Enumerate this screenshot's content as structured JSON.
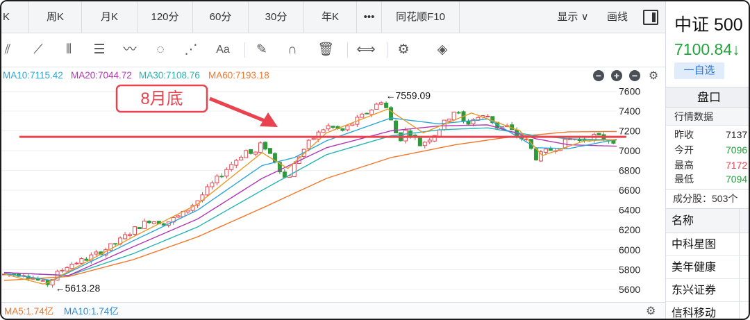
{
  "tabs": [
    {
      "label": "K"
    },
    {
      "label": "周K"
    },
    {
      "label": "月K"
    },
    {
      "label": "120分"
    },
    {
      "label": "60分"
    },
    {
      "label": "30分"
    },
    {
      "label": "年K"
    },
    {
      "label": "•••"
    },
    {
      "label": "同花顺F10"
    }
  ],
  "tab_right": {
    "display_label": "显示 ∨",
    "draw_label": "画线"
  },
  "ma_legend": [
    {
      "label": "MA10:7115.42",
      "color": "#2aa6d8"
    },
    {
      "label": "MA20:7044.72",
      "color": "#b235b3"
    },
    {
      "label": "MA30:7108.76",
      "color": "#27b3b3"
    },
    {
      "label": "MA60:7193.18",
      "color": "#f2762a"
    }
  ],
  "volume_legend": [
    {
      "label": "MA5:1.74亿",
      "color": "#f2762a"
    },
    {
      "label": "MA10:1.74亿",
      "color": "#2a8ad8"
    }
  ],
  "annotation": {
    "text": "8月底",
    "color": "#e8434f"
  },
  "chart_data": {
    "type": "candlestick",
    "ylim": [
      5480,
      7680
    ],
    "yticks": [
      5600,
      5800,
      6000,
      6200,
      6400,
      6600,
      6800,
      7000,
      7200,
      7400,
      7600
    ],
    "high_label": "←7559.09",
    "low_label": "←5613.28",
    "horizontal_line": 7140,
    "colors": {
      "up": "#e8434f",
      "down": "#2e9a3a",
      "ma5": "#e89a2a",
      "ma10": "#2aa6d8",
      "ma20": "#b235b3",
      "ma30": "#27b3b3",
      "ma60": "#f2762a",
      "hline": "#e8434f"
    },
    "ohlc_anchors": [
      [
        0,
        5750
      ],
      [
        12,
        5760
      ],
      [
        20,
        5700
      ],
      [
        26,
        5640
      ],
      [
        33,
        5760
      ],
      [
        40,
        5850
      ],
      [
        50,
        5900
      ],
      [
        60,
        5980
      ],
      [
        70,
        6070
      ],
      [
        80,
        6200
      ],
      [
        90,
        6300
      ],
      [
        100,
        6270
      ],
      [
        110,
        6350
      ],
      [
        120,
        6500
      ],
      [
        130,
        6680
      ],
      [
        140,
        6850
      ],
      [
        150,
        7000
      ],
      [
        155,
        6950
      ],
      [
        160,
        7080
      ],
      [
        168,
        6900
      ],
      [
        175,
        6700
      ],
      [
        183,
        6950
      ],
      [
        190,
        7100
      ],
      [
        200,
        7250
      ],
      [
        210,
        7200
      ],
      [
        218,
        7300
      ],
      [
        228,
        7420
      ],
      [
        235,
        7520
      ],
      [
        240,
        7300
      ],
      [
        245,
        7100
      ],
      [
        250,
        7220
      ],
      [
        258,
        7060
      ],
      [
        266,
        7150
      ],
      [
        274,
        7300
      ],
      [
        280,
        7420
      ],
      [
        286,
        7260
      ],
      [
        292,
        7330
      ],
      [
        300,
        7350
      ],
      [
        306,
        7240
      ],
      [
        312,
        7240
      ],
      [
        318,
        7150
      ],
      [
        324,
        7100
      ],
      [
        330,
        6930
      ],
      [
        336,
        6990
      ],
      [
        344,
        7040
      ],
      [
        352,
        7130
      ],
      [
        358,
        7100
      ],
      [
        366,
        7150
      ],
      [
        372,
        7120
      ],
      [
        380,
        7100
      ]
    ],
    "ma_anchors": {
      "ma60": [
        [
          0,
          5690
        ],
        [
          40,
          5730
        ],
        [
          80,
          5900
        ],
        [
          120,
          6130
        ],
        [
          160,
          6420
        ],
        [
          200,
          6720
        ],
        [
          240,
          6930
        ],
        [
          280,
          7060
        ],
        [
          310,
          7130
        ],
        [
          350,
          7190
        ],
        [
          380,
          7193
        ]
      ],
      "ma30": [
        [
          0,
          5770
        ],
        [
          40,
          5740
        ],
        [
          80,
          5960
        ],
        [
          120,
          6230
        ],
        [
          160,
          6600
        ],
        [
          200,
          6960
        ],
        [
          240,
          7150
        ],
        [
          270,
          7210
        ],
        [
          300,
          7230
        ],
        [
          330,
          7150
        ],
        [
          350,
          7120
        ],
        [
          380,
          7108
        ]
      ],
      "ma20": [
        [
          0,
          5770
        ],
        [
          40,
          5740
        ],
        [
          80,
          6030
        ],
        [
          120,
          6310
        ],
        [
          160,
          6720
        ],
        [
          200,
          7030
        ],
        [
          240,
          7200
        ],
        [
          270,
          7250
        ],
        [
          300,
          7260
        ],
        [
          330,
          7120
        ],
        [
          350,
          7060
        ],
        [
          380,
          7045
        ]
      ],
      "ma10": [
        [
          0,
          5760
        ],
        [
          30,
          5690
        ],
        [
          80,
          6090
        ],
        [
          120,
          6400
        ],
        [
          160,
          6850
        ],
        [
          180,
          6930
        ],
        [
          200,
          7100
        ],
        [
          240,
          7330
        ],
        [
          270,
          7270
        ],
        [
          300,
          7320
        ],
        [
          330,
          7030
        ],
        [
          350,
          7020
        ],
        [
          380,
          7115
        ]
      ],
      "ma5": [
        [
          0,
          5755
        ],
        [
          25,
          5650
        ],
        [
          80,
          6130
        ],
        [
          120,
          6460
        ],
        [
          160,
          6980
        ],
        [
          176,
          6820
        ],
        [
          200,
          7180
        ],
        [
          238,
          7420
        ],
        [
          260,
          7180
        ],
        [
          290,
          7380
        ],
        [
          320,
          7200
        ],
        [
          334,
          6950
        ],
        [
          360,
          7100
        ],
        [
          380,
          7110
        ]
      ]
    }
  },
  "panel": {
    "name": "中证 500",
    "price": "7100.84↓",
    "watch_button": "一自选",
    "header": "盘口",
    "subheader": "行情数据",
    "quotes": [
      {
        "label": "昨收",
        "value": "7137",
        "color": "#222222"
      },
      {
        "label": "今开",
        "value": "7096",
        "color": "#24a33c"
      },
      {
        "label": "最高",
        "value": "7172",
        "color": "#e8434f"
      },
      {
        "label": "最低",
        "value": "7094",
        "color": "#24a33c"
      }
    ],
    "count_label": "成分股：503个",
    "list_header": "名称",
    "items": [
      "中科星图",
      "美年健康",
      "东兴证券",
      "信科移动"
    ]
  }
}
